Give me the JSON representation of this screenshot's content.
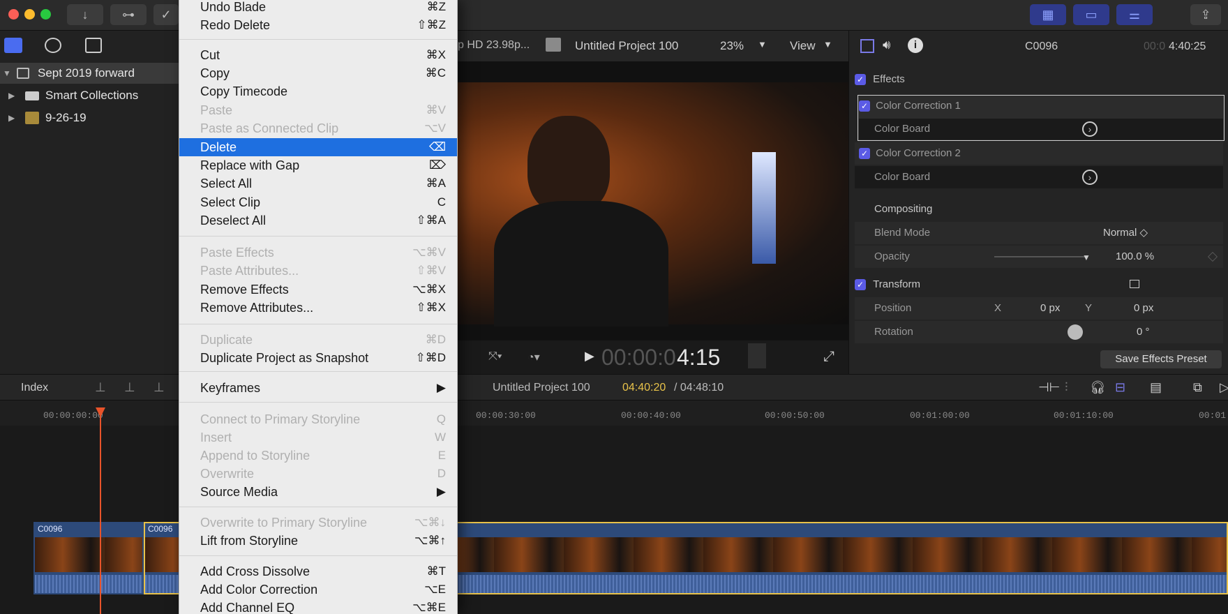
{
  "window": {
    "buttons": [
      "↓",
      "⊶",
      "✓"
    ],
    "right_buttons": [
      "▦",
      "▭",
      "⚌",
      "⇪"
    ]
  },
  "browser": {
    "library": "Sept 2019 forward",
    "items": [
      "Smart Collections",
      "9-26-19"
    ]
  },
  "viewer": {
    "format": "p HD 23.98p...",
    "project": "Untitled Project 100",
    "zoom": "23%",
    "view": "View",
    "timecode_dim": "00:00:0",
    "timecode": "4:15"
  },
  "inspector": {
    "clip": "C0096",
    "duration_dim": "00:0",
    "duration": "4:40:25",
    "effects_label": "Effects",
    "cc1": "Color Correction 1",
    "cb1": "Color Board",
    "cc2": "Color Correction 2",
    "cb2": "Color Board",
    "compositing": "Compositing",
    "blend_label": "Blend Mode",
    "blend_value": "Normal ◇",
    "opacity_label": "Opacity",
    "opacity_value": "100.0 %",
    "transform": "Transform",
    "position_label": "Position",
    "pos_x_label": "X",
    "pos_x": "0 px",
    "pos_y_label": "Y",
    "pos_y": "0 px",
    "rotation_label": "Rotation",
    "rotation_value": "0 °",
    "save_preset": "Save Effects Preset"
  },
  "timeline": {
    "index": "Index",
    "project": "Untitled Project 100",
    "current": "04:40:20",
    "total": "/ 04:48:10",
    "ticks": [
      "00:00:00:00",
      "00:00:30:00",
      "00:00:40:00",
      "00:00:50:00",
      "00:01:00:00",
      "00:01:10:00",
      "00:01"
    ],
    "clip_a": "C0096",
    "clip_b": "C0096"
  },
  "menu": [
    {
      "label": "Undo Blade",
      "shortcut": "⌘Z",
      "state": "normal"
    },
    {
      "label": "Redo Delete",
      "shortcut": "⇧⌘Z",
      "state": "normal"
    },
    {
      "label": "Cut",
      "shortcut": "⌘X",
      "state": "normal"
    },
    {
      "label": "Copy",
      "shortcut": "⌘C",
      "state": "normal"
    },
    {
      "label": "Copy Timecode",
      "shortcut": "",
      "state": "normal"
    },
    {
      "label": "Paste",
      "shortcut": "⌘V",
      "state": "disabled"
    },
    {
      "label": "Paste as Connected Clip",
      "shortcut": "⌥V",
      "state": "disabled"
    },
    {
      "label": "Delete",
      "shortcut": "⌫",
      "state": "selected"
    },
    {
      "label": "Replace with Gap",
      "shortcut": "⌦",
      "state": "normal"
    },
    {
      "label": "Select All",
      "shortcut": "⌘A",
      "state": "normal"
    },
    {
      "label": "Select Clip",
      "shortcut": "C",
      "state": "normal"
    },
    {
      "label": "Deselect All",
      "shortcut": "⇧⌘A",
      "state": "normal"
    },
    {
      "label": "Paste Effects",
      "shortcut": "⌥⌘V",
      "state": "disabled"
    },
    {
      "label": "Paste Attributes...",
      "shortcut": "⇧⌘V",
      "state": "disabled"
    },
    {
      "label": "Remove Effects",
      "shortcut": "⌥⌘X",
      "state": "normal"
    },
    {
      "label": "Remove Attributes...",
      "shortcut": "⇧⌘X",
      "state": "normal"
    },
    {
      "label": "Duplicate",
      "shortcut": "⌘D",
      "state": "disabled"
    },
    {
      "label": "Duplicate Project as Snapshot",
      "shortcut": "⇧⌘D",
      "state": "normal"
    },
    {
      "label": "Keyframes",
      "shortcut": "▶",
      "state": "normal"
    },
    {
      "label": "Connect to Primary Storyline",
      "shortcut": "Q",
      "state": "disabled"
    },
    {
      "label": "Insert",
      "shortcut": "W",
      "state": "disabled"
    },
    {
      "label": "Append to Storyline",
      "shortcut": "E",
      "state": "disabled"
    },
    {
      "label": "Overwrite",
      "shortcut": "D",
      "state": "disabled"
    },
    {
      "label": "Source Media",
      "shortcut": "▶",
      "state": "normal"
    },
    {
      "label": "Overwrite to Primary Storyline",
      "shortcut": "⌥⌘↓",
      "state": "disabled"
    },
    {
      "label": "Lift from Storyline",
      "shortcut": "⌥⌘↑",
      "state": "normal"
    },
    {
      "label": "Add Cross Dissolve",
      "shortcut": "⌘T",
      "state": "normal"
    },
    {
      "label": "Add Color Correction",
      "shortcut": "⌥E",
      "state": "normal"
    },
    {
      "label": "Add Channel EQ",
      "shortcut": "⌥⌘E",
      "state": "normal"
    }
  ]
}
